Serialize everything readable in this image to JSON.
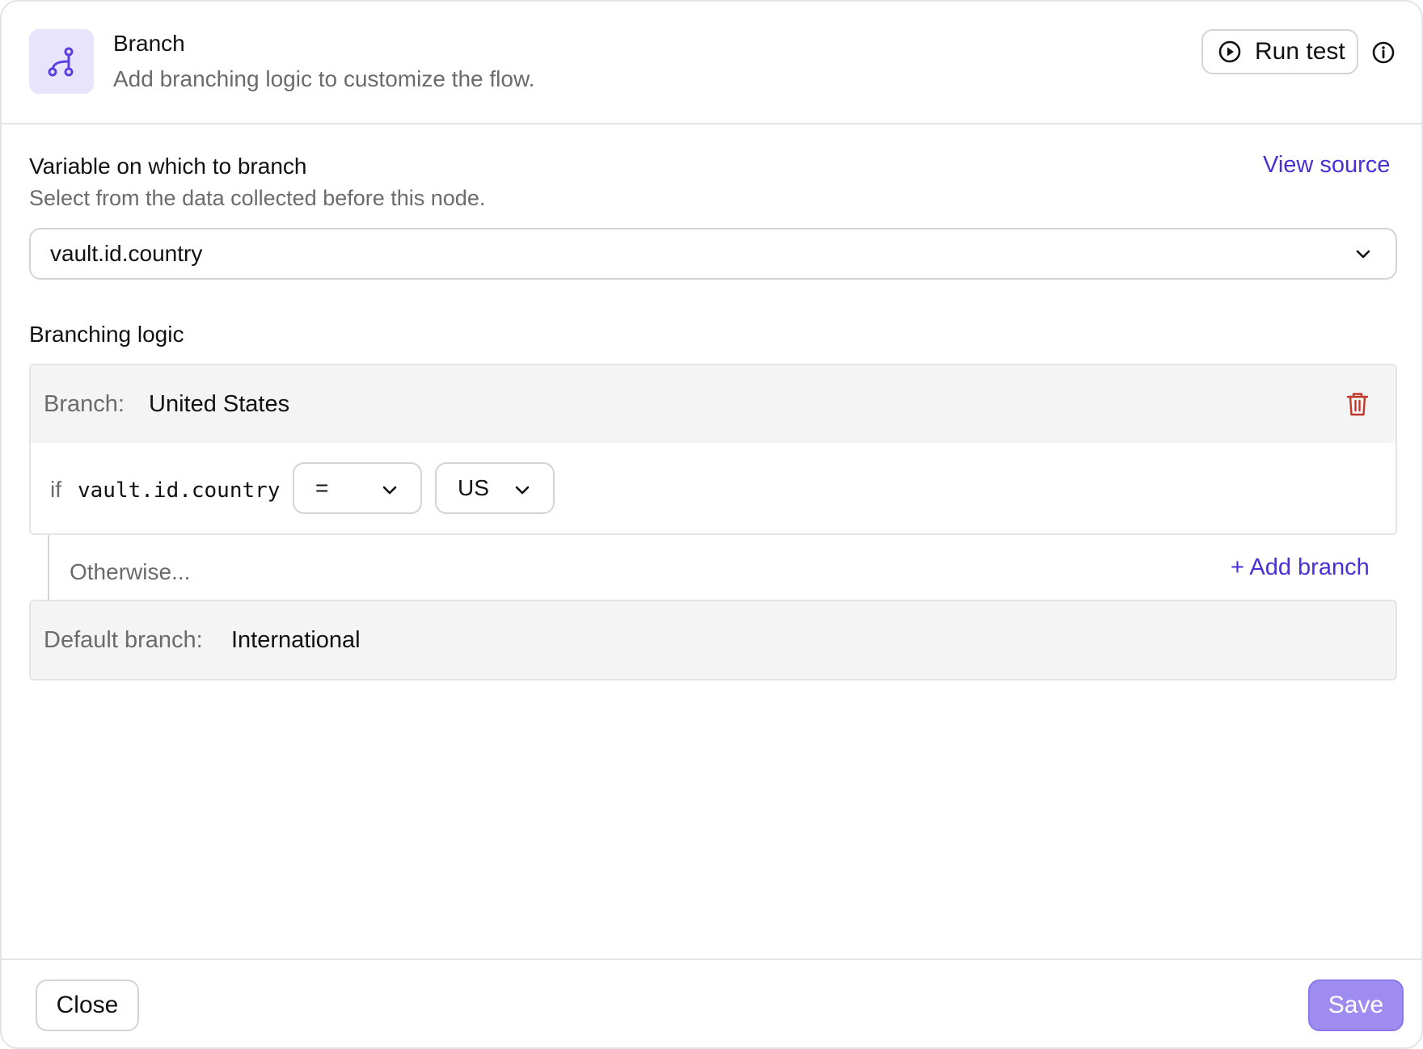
{
  "header": {
    "icon": "branch-icon",
    "title": "Branch",
    "subtitle": "Add branching logic to customize the flow.",
    "run_test_label": "Run test",
    "run_test_icon": "play-circle-icon",
    "info_icon": "info-icon"
  },
  "variable": {
    "title": "Variable on which to branch",
    "subtitle": "Select from the data collected before this node.",
    "view_source_label": "View source",
    "selected_value": "vault.id.country"
  },
  "branching_logic": {
    "title": "Branching logic",
    "branches": [
      {
        "key_label": "Branch:",
        "name": "United States",
        "condition": {
          "if_label": "if",
          "variable": "vault.id.country",
          "operator": "=",
          "value": "US"
        }
      }
    ],
    "otherwise_label": "Otherwise...",
    "add_branch_label": "+ Add branch",
    "default_branch": {
      "key_label": "Default branch:",
      "name": "International"
    }
  },
  "footer": {
    "close_label": "Close",
    "save_label": "Save"
  },
  "colors": {
    "accent": "#4b2fd6",
    "save_button": "#9f8cf0",
    "icon_bg": "#e9e4fe",
    "delete": "#c0392b"
  }
}
